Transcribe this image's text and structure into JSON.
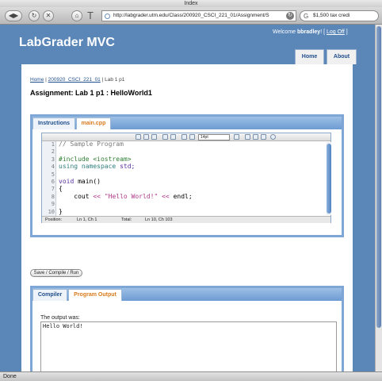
{
  "browser": {
    "window_title": "Index",
    "url": "http://labgrader.utm.edu/Class/200920_CSCI_221_01/Assignment/S",
    "search_text": "$1,500 tax credi",
    "status": "Done"
  },
  "site": {
    "title": "LabGrader MVC",
    "welcome_prefix": "Welcome",
    "username": "bbradley",
    "welcome_suffix": "!",
    "logoff_label": "Log Off",
    "nav": [
      "Home",
      "About"
    ]
  },
  "breadcrumb": {
    "home": "Home",
    "class": "200920_CSCI_221_01",
    "current": "Lab 1 p1"
  },
  "assignment_title": "Assignment: Lab 1 p1 : HelloWorld1",
  "editor_tabs": [
    "Instructions",
    "main.cpp"
  ],
  "editor": {
    "font_size": "14pt",
    "line_numbers": [
      "1",
      "2",
      "3",
      "4",
      "5",
      "6",
      "7",
      "8",
      "9",
      "10"
    ],
    "lines": {
      "l1": "// Sample Program",
      "l3": "#include <iostream>",
      "l4_kw": "using namespace",
      "l4_rest": "std;",
      "l6_kw": "void",
      "l6_rest": "main()",
      "l7": "{",
      "l8_a": "    cout",
      "l8_op1": "<<",
      "l8_str": "\"Hello World!\"",
      "l8_op2": "<<",
      "l8_b": "endl;",
      "l10": "}"
    },
    "status": {
      "position_label": "Position:",
      "position_value": "Ln 1, Ch 1",
      "total_label": "Total:",
      "total_value": "Ln 10, Ch 103"
    }
  },
  "run_button": "Save / Compile / Run",
  "output_tabs": [
    "Compiler",
    "Program Output"
  ],
  "output": {
    "label": "The output was:",
    "text": "Hello World!"
  }
}
